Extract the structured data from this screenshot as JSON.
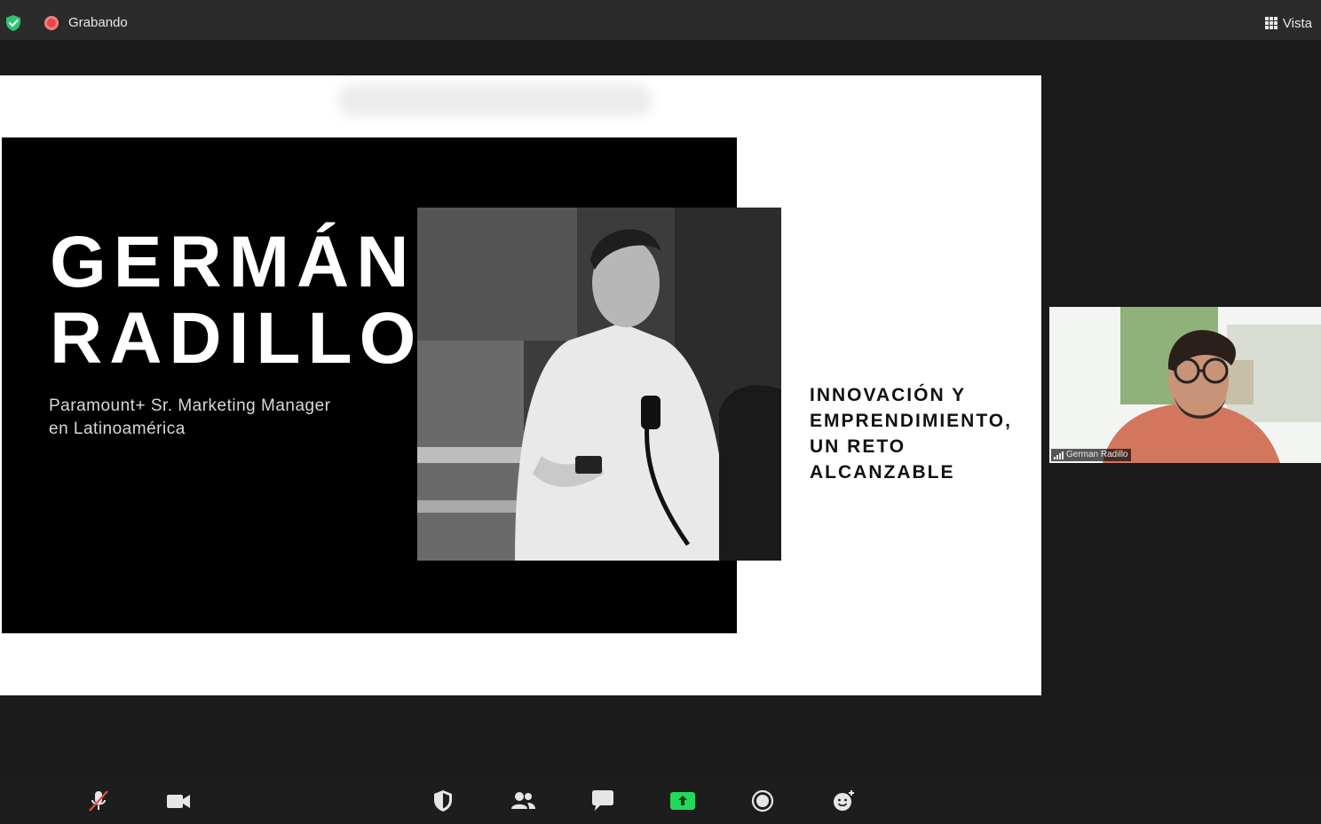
{
  "topbar": {
    "recording_label": "Grabando",
    "view_label": "Vista",
    "security_icon": "shield-check-icon",
    "recording_icon": "recording-dot-icon",
    "view_icon": "grid-icon"
  },
  "slide": {
    "name_first": "GERMÁN",
    "name_last": "RADILLO",
    "subtitle_line1": "Paramount+ Sr. Marketing Manager",
    "subtitle_line2": "en Latinoamérica",
    "headline_line1": "INNOVACIÓN Y",
    "headline_line2": "EMPRENDIMIENTO,",
    "headline_line3": "UN RETO",
    "headline_line4": "ALCANZABLE"
  },
  "participant": {
    "name": "German Radillo"
  },
  "toolbar": {
    "items": [
      "muted-microphone-icon",
      "video-camera-icon",
      "security-shield-icon",
      "participants-icon",
      "chat-icon",
      "share-screen-icon",
      "record-icon",
      "reactions-icon"
    ]
  },
  "colors": {
    "topbar": "#2b2b2c",
    "background": "#1a1a1a",
    "recording": "#e5484d",
    "share_green": "#23d959",
    "security_green": "#2ac56b"
  }
}
